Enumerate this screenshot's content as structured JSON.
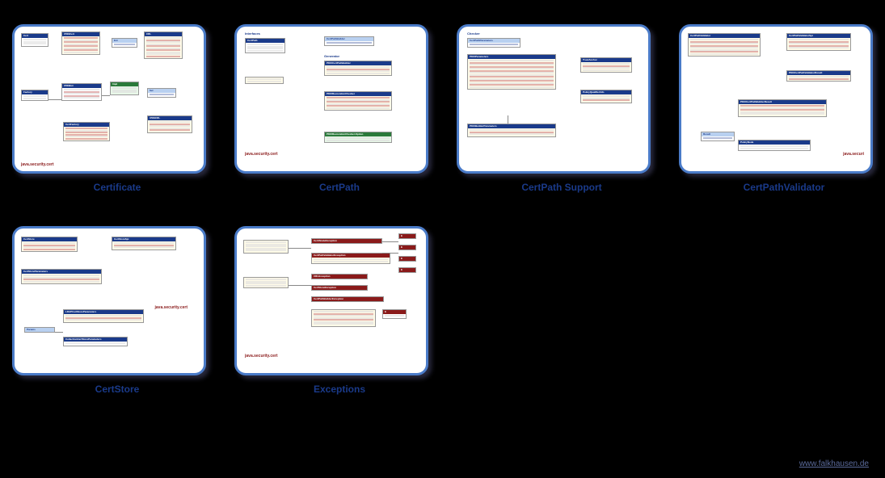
{
  "cards": [
    {
      "label": "Certificate",
      "pkg": "java.security.cert"
    },
    {
      "label": "CertPath",
      "pkg": "java.security.cert"
    },
    {
      "label": "CertPath Support",
      "pkg": ""
    },
    {
      "label": "CertPathValidator",
      "pkg": "java.securi"
    },
    {
      "label": "CertStore",
      "pkg": "java.security.cert"
    },
    {
      "label": "Exceptions",
      "pkg": "java.security.cert"
    }
  ],
  "footer": "www.falkhausen.de",
  "sections": {
    "interfaces": "Interfaces",
    "generator": "Generator",
    "checker": "Checker"
  },
  "uml_headers": {
    "certpath": "CertPath",
    "pkix_params": "PKIXParameters",
    "trust_anchor": "TrustAnchor",
    "policy_qual": "PolicyQualifierInfo",
    "cert_exc": "CertificateException",
    "crl_exc": "CRLException",
    "certstore_exc": "CertStoreException",
    "certpath_val_exc": "CertPathValidatorException"
  }
}
